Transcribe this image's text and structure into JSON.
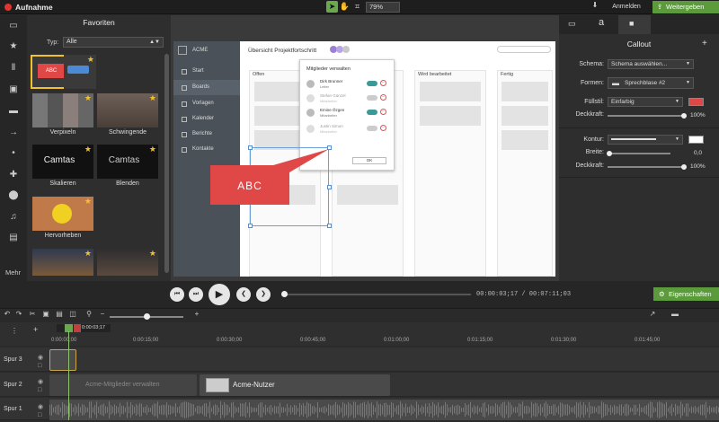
{
  "app": {
    "title": "Aufnahme",
    "zoom": "79%",
    "login": "Anmelden",
    "share": "Weitergeben"
  },
  "left_more": "Mehr",
  "favorites": {
    "title": "Favoriten",
    "type_label": "Typ:",
    "type_value": "Alle",
    "tiles": [
      {
        "label": "",
        "text": "ABC"
      },
      {
        "label": "",
        "text": ""
      },
      {
        "label": "Verpixeln",
        "text": ""
      },
      {
        "label": "Schwingende",
        "text": ""
      },
      {
        "label": "Skalieren",
        "text": "Camtas"
      },
      {
        "label": "Blenden",
        "text": "Camtas"
      },
      {
        "label": "Hervorheben",
        "text": ""
      },
      {
        "label": "",
        "text": ""
      },
      {
        "label": "",
        "text": ""
      }
    ]
  },
  "canvas": {
    "brand": "ACME",
    "nav": [
      "Start",
      "Boards",
      "Vorlagen",
      "Kalender",
      "Berichte",
      "Kontakte"
    ],
    "project_title": "Übersicht Projektfortschritt",
    "columns": [
      "Offen",
      "",
      "Wird bearbeitet",
      "Fertig"
    ],
    "dialog": {
      "title": "Mitglieder verwalten",
      "members": [
        {
          "name": "Dirk Brunner",
          "role": "Leiter"
        },
        {
          "name": "Stefan Günzel",
          "role": "Mitarbeiter"
        },
        {
          "name": "Emine Özgen",
          "role": "Mitarbeiter"
        },
        {
          "name": "Justin Simon",
          "role": "Mitarbeiter"
        }
      ],
      "ok": "OK"
    },
    "callout_text": "ABC"
  },
  "properties": {
    "tab_text": "a",
    "title": "Callout",
    "schema_label": "Schema:",
    "schema_value": "Schema auswählen...",
    "forms_label": "Formen:",
    "forms_value": "Sprechblase #2",
    "fill_label": "Füllstil:",
    "fill_value": "Einfarbig",
    "opacity_label": "Deckkraft:",
    "opacity_value": "100%",
    "outline_label": "Kontur:",
    "width_label": "Breite:",
    "width_value": "0,0",
    "opacity2_label": "Deckkraft:",
    "opacity2_value": "100%",
    "fill_color": "#e04848",
    "outline_color": "#ffffff"
  },
  "playback": {
    "timecode": "00:00:03;17 / 00:07:11;03",
    "properties_button": "Eigenschaften"
  },
  "timeline": {
    "playhead_time": "0:00:03;17",
    "ticks": [
      "0:00:00;00",
      "0:00:15;00",
      "0:00:30;00",
      "0:00:45;00",
      "0:01:00;00",
      "0:01:15;00",
      "0:01:30;00",
      "0:01:45;00"
    ],
    "tracks": [
      {
        "label": "Spur 3"
      },
      {
        "label": "Spur 2"
      },
      {
        "label": "Spur 1"
      }
    ],
    "clip_faded": "Acme-Mitglieder verwalten",
    "clip_main": "Acme-Nutzer"
  },
  "colors": {
    "accent_green": "#5b9b3c",
    "record_red": "#e0352f",
    "callout_red": "#e04848",
    "star": "#f2c12e"
  }
}
